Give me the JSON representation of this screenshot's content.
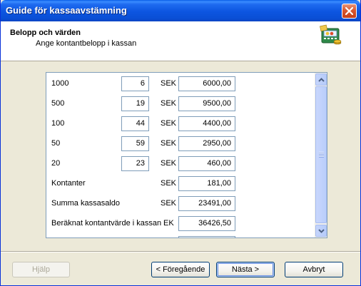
{
  "window": {
    "title": "Guide för kassaavstämning"
  },
  "header": {
    "title": "Belopp och värden",
    "subtitle": "Ange kontantbelopp i kassan",
    "icon": "cash-register-icon"
  },
  "denominations": [
    {
      "label": "1000",
      "quantity": "6",
      "currency": "SEK",
      "amount": "6000,00"
    },
    {
      "label": "500",
      "quantity": "19",
      "currency": "SEK",
      "amount": "9500,00"
    },
    {
      "label": "100",
      "quantity": "44",
      "currency": "SEK",
      "amount": "4400,00"
    },
    {
      "label": "50",
      "quantity": "59",
      "currency": "SEK",
      "amount": "2950,00"
    },
    {
      "label": "20",
      "quantity": "23",
      "currency": "SEK",
      "amount": "460,00"
    }
  ],
  "summary": [
    {
      "label": "Kontanter",
      "currency": "SEK",
      "amount": "181,00"
    },
    {
      "label": "Summa kassasaldo",
      "currency": "SEK",
      "amount": "23491,00"
    },
    {
      "label": "Beräknat kontantvärde i kassan",
      "currency": "EK",
      "amount": "36426,50"
    }
  ],
  "buttons": {
    "help": "Hjälp",
    "back": "< Föregående",
    "next": "Nästa >",
    "cancel": "Avbryt"
  }
}
